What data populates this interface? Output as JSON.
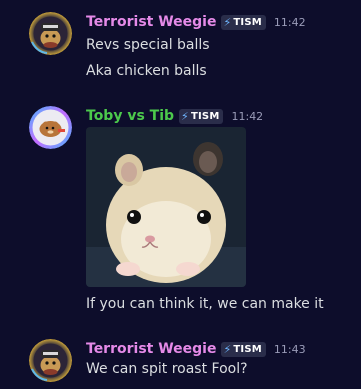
{
  "colors": {
    "background": "#0d0d2b",
    "weegie_name": "#e58ae8",
    "toby_name": "#4cc94c",
    "tag_bolt": "#6fb6ff",
    "timestamp": "#9a9cb8"
  },
  "messages": [
    {
      "author": "Terrorist Weegie",
      "tag": "TISM",
      "tag_icon": "lightning-bolt-icon",
      "time": "11:42",
      "lines": [
        "Revs special balls",
        "Aka chicken balls"
      ]
    },
    {
      "author": "Toby vs Tib",
      "tag": "TISM",
      "tag_icon": "lightning-bolt-icon",
      "time": "11:42",
      "attachment": "hamster-image",
      "lines": [
        "If you can think it, we can make it"
      ]
    },
    {
      "author": "Terrorist Weegie",
      "tag": "TISM",
      "tag_icon": "lightning-bolt-icon",
      "time": "11:43",
      "lines": [
        "We can spit roast Fool?"
      ]
    }
  ]
}
